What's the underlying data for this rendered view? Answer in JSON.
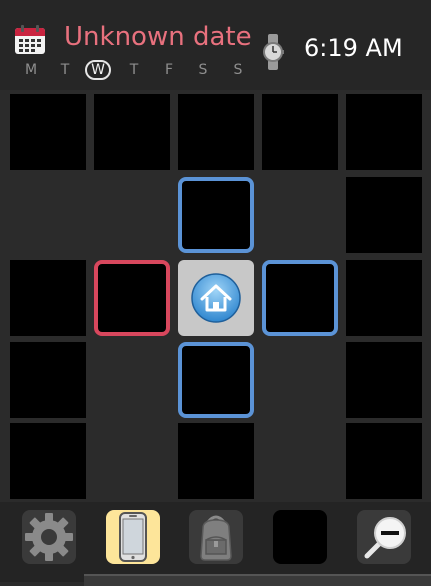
{
  "header": {
    "date_label": "Unknown date",
    "time_label": "6:19 AM",
    "calendar_icon": "calendar-icon",
    "watch_icon": "wristwatch-icon",
    "weekdays": [
      {
        "label": "M",
        "active": false
      },
      {
        "label": "T",
        "active": false
      },
      {
        "label": "W",
        "active": true
      },
      {
        "label": "T",
        "active": false
      },
      {
        "label": "F",
        "active": false
      },
      {
        "label": "S",
        "active": false
      },
      {
        "label": "S",
        "active": false
      }
    ]
  },
  "grid": {
    "center_icon": "home-icon",
    "highlight_colors": {
      "blue": "#5b93d6",
      "red": "#d8475d",
      "home_bg": "#c8c8c8"
    }
  },
  "dock": {
    "items": [
      {
        "name": "settings-gear-button",
        "icon": "gear-icon"
      },
      {
        "name": "phone-button",
        "icon": "smartphone-icon",
        "selected": true
      },
      {
        "name": "backpack-button",
        "icon": "backpack-icon"
      },
      {
        "name": "empty-slot-button",
        "icon": ""
      },
      {
        "name": "zoom-out-button",
        "icon": "magnifier-minus-icon"
      }
    ],
    "accent": "#fde59a"
  }
}
